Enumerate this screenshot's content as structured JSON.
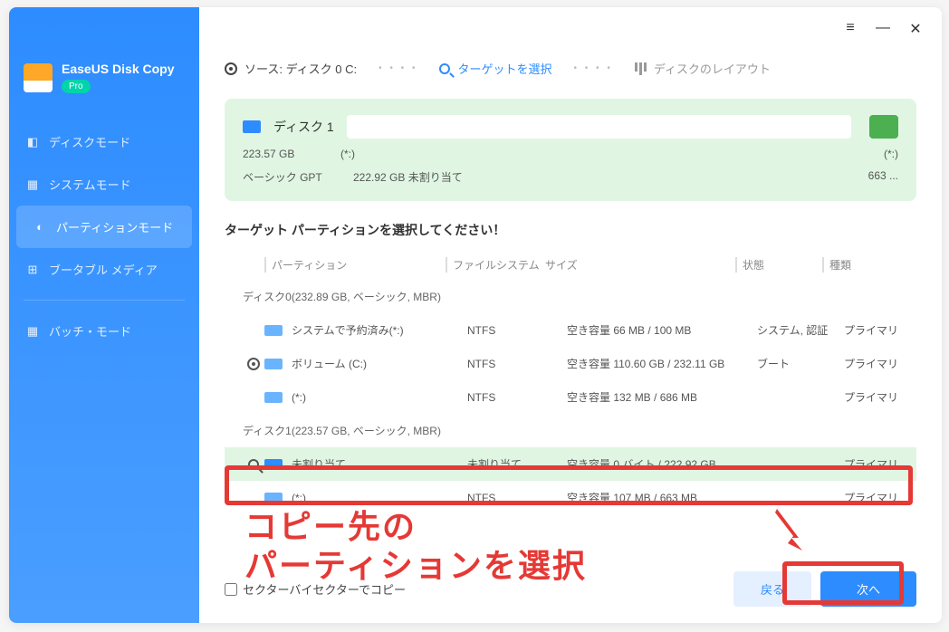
{
  "app": {
    "title": "EaseUS Disk Copy",
    "badge": "Pro"
  },
  "nav": {
    "disk_mode": "ディスクモード",
    "system_mode": "システムモード",
    "partition_mode": "パーティションモード",
    "bootable_media": "ブータブル メディア",
    "batch_mode": "バッチ・モード"
  },
  "crumb": {
    "source_label": "ソース: ディスク 0 C:",
    "target_label": "ターゲットを選択",
    "layout_label": "ディスクのレイアウト"
  },
  "disk_summary": {
    "name": "ディスク 1",
    "size": "223.57 GB",
    "type": "ベーシック GPT",
    "seg1_label": "(*:)",
    "seg1_value": "222.92 GB 未割り当て",
    "seg2_label": "(*:)",
    "seg2_value": "663 ..."
  },
  "instruction": "ターゲット パーティションを選択してください！",
  "columns": {
    "partition": "パーティション",
    "filesystem": "ファイルシステム",
    "size": "サイズ",
    "state": "状態",
    "kind": "種類"
  },
  "groups": [
    {
      "label": "ディスク0(232.89 GB, ベーシック, MBR)"
    },
    {
      "label": "ディスク1(223.57 GB, ベーシック, MBR)"
    }
  ],
  "rows": {
    "d0r0": {
      "name": "システムで予約済み(*:)",
      "fs": "NTFS",
      "size": "空き容量 66 MB / 100 MB",
      "state": "システム, 認証",
      "kind": "プライマリ"
    },
    "d0r1": {
      "name": "ボリューム (C:)",
      "fs": "NTFS",
      "size": "空き容量 110.60 GB / 232.11 GB",
      "state": "ブート",
      "kind": "プライマリ"
    },
    "d0r2": {
      "name": "(*:)",
      "fs": "NTFS",
      "size": "空き容量 132 MB / 686 MB",
      "state": "",
      "kind": "プライマリ"
    },
    "d1r0": {
      "name": "未割り当て",
      "fs": "未割り当て",
      "size": "空き容量 0 バイト / 222.92 GB",
      "state": "",
      "kind": "プライマリ"
    },
    "d1r1": {
      "name": "(*:)",
      "fs": "NTFS",
      "size": "空き容量 107 MB / 663 MB",
      "state": "",
      "kind": "プライマリ"
    }
  },
  "bottom": {
    "sector_copy": "セクターバイセクターでコピー",
    "back": "戻る",
    "next": "次へ"
  },
  "annotation": {
    "line1": "コピー先の",
    "line2": "パーティションを選択"
  }
}
